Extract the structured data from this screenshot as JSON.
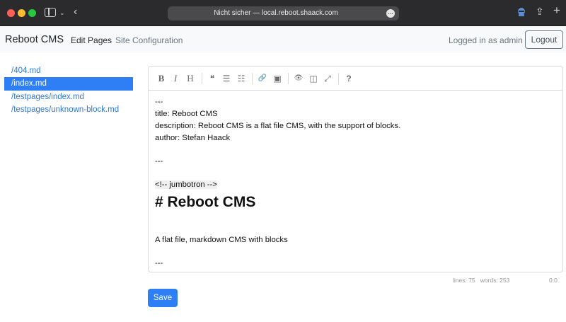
{
  "browser": {
    "url": "Nicht sicher — local.reboot.shaack.com"
  },
  "navbar": {
    "brand": "Reboot CMS",
    "edit_pages": "Edit Pages",
    "site_configuration": "Site Configuration",
    "logged_in": "Logged in as admin",
    "logout": "Logout"
  },
  "files": [
    {
      "label": "/404.md",
      "active": false
    },
    {
      "label": "/index.md",
      "active": true
    },
    {
      "label": "/testpages/index.md",
      "active": false
    },
    {
      "label": "/testpages/unknown-block.md",
      "active": false
    }
  ],
  "toolbar": {
    "bold": "B",
    "italic": "I",
    "heading": "H",
    "quote": "❝",
    "bullet_list": "☰",
    "numbered_list": "☷",
    "link": "🔗",
    "image": "▣",
    "preview": "👁",
    "side_by_side": "◫",
    "fullscreen": "⤢",
    "help": "?"
  },
  "editor": {
    "lines": [
      "---",
      "title: Reboot CMS",
      "description: Reboot CMS is a flat file CMS, with the support of blocks.",
      "author: Stefan Haack",
      "",
      "---",
      "",
      "<!-- jumbotron -->",
      "# Reboot CMS",
      "",
      "A flat file, markdown CMS with blocks",
      "",
      "---"
    ]
  },
  "status": {
    "lines": "lines: 75",
    "words": "words: 253",
    "cursor": "0:0"
  },
  "save_label": "Save"
}
